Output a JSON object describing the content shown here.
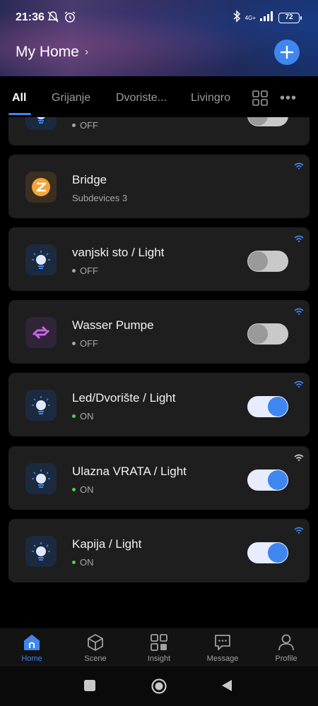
{
  "status_bar": {
    "time": "21:36",
    "network": "4G+",
    "battery": "72"
  },
  "header": {
    "title": "My Home",
    "chevron": "›"
  },
  "tabs": [
    {
      "label": "All",
      "active": true
    },
    {
      "label": "Grijanje",
      "active": false
    },
    {
      "label": "Dvoriste...",
      "active": false
    },
    {
      "label": "Livingro",
      "active": false
    }
  ],
  "more_label": "•••",
  "partial_card": {
    "status": "OFF"
  },
  "devices": [
    {
      "name": "Bridge",
      "sub": "Subdevices 3",
      "icon": "zigbee-bridge-icon"
    },
    {
      "name": "vanjski sto / Light",
      "status": "OFF",
      "icon": "bulb-icon"
    },
    {
      "name": "Wasser Pumpe",
      "status": "OFF",
      "icon": "pump-icon"
    },
    {
      "name": "Led/Dvorište / Light",
      "status": "ON",
      "icon": "bulb-icon"
    },
    {
      "name": "Ulazna VRATA / Light",
      "status": "ON",
      "icon": "bulb-icon"
    },
    {
      "name": "Kapija / Light",
      "status": "ON",
      "icon": "bulb-icon"
    }
  ],
  "bottom_nav": [
    {
      "label": "Home",
      "icon": "home-icon",
      "active": true
    },
    {
      "label": "Scene",
      "icon": "scene-icon",
      "active": false
    },
    {
      "label": "Insight",
      "icon": "insight-icon",
      "active": false
    },
    {
      "label": "Message",
      "icon": "message-icon",
      "active": false
    },
    {
      "label": "Profile",
      "icon": "profile-icon",
      "active": false
    }
  ],
  "colors": {
    "accent": "#3f86f0",
    "on_dot": "#4ed24e",
    "card_bg": "#1e1e1e"
  }
}
